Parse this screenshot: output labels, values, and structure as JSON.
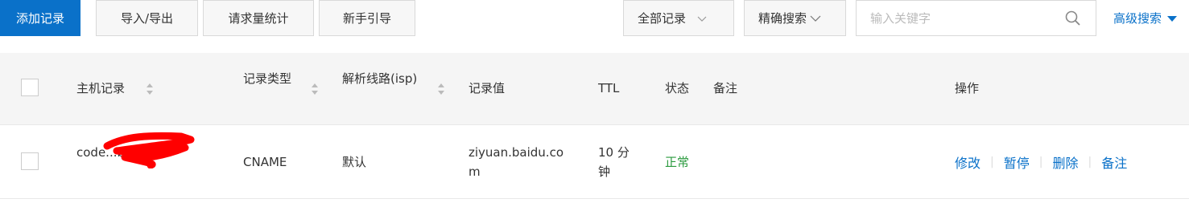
{
  "toolbar": {
    "add_label": "添加记录",
    "import_label": "导入/导出",
    "stats_label": "请求量统计",
    "guide_label": "新手引导",
    "filter_selected": "全部记录",
    "search_mode": "精确搜索",
    "search_placeholder": "输入关键字",
    "advanced_label": "高级搜索"
  },
  "table": {
    "headers": {
      "host": "主机记录",
      "type": "记录类型",
      "line": "解析线路(isp)",
      "value": "记录值",
      "ttl": "TTL",
      "status": "状态",
      "note": "备注",
      "ops": "操作"
    },
    "rows": [
      {
        "host": "code...blogs",
        "type": "CNAME",
        "line": "默认",
        "value": "ziyuan.baidu.com",
        "ttl": "10 分钟",
        "status": "正常",
        "note": "",
        "ops": {
          "edit": "修改",
          "pause": "暂停",
          "delete": "删除",
          "note": "备注"
        }
      }
    ]
  },
  "colors": {
    "accent": "#0a71c9",
    "status_ok": "#2a9a3e",
    "redaction": "#ff0000"
  }
}
